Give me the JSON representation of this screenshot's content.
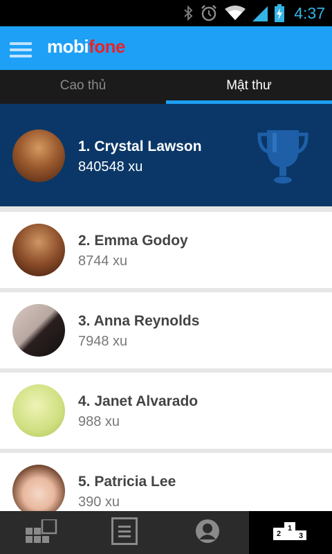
{
  "status_bar": {
    "time": "4:37",
    "icons": [
      "bluetooth-icon",
      "alarm-icon",
      "wifi-icon",
      "signal-icon",
      "battery-charging-icon"
    ]
  },
  "header": {
    "menu_icon": "hamburger-menu-icon",
    "logo_part1": "mobi",
    "logo_part2": "fone",
    "colors": {
      "bar": "#1ea0f7",
      "logo_accent": "#e8232a"
    }
  },
  "tabs": [
    {
      "label": "Cao thủ",
      "active": false
    },
    {
      "label": "Mật thư",
      "active": true
    }
  ],
  "leaderboard": [
    {
      "name": "1. Crystal Lawson",
      "score": "840548 xu",
      "badge_icon": "trophy-icon"
    },
    {
      "name": "2. Emma Godoy",
      "score": "8744 xu"
    },
    {
      "name": "3. Anna Reynolds",
      "score": "7948 xu"
    },
    {
      "name": "4. Janet Alvarado",
      "score": "988 xu"
    },
    {
      "name": "5. Patricia Lee",
      "score": "390 xu"
    }
  ],
  "bottom_nav": [
    {
      "icon": "tiles-icon",
      "active": false
    },
    {
      "icon": "document-list-icon",
      "active": false
    },
    {
      "icon": "profile-icon",
      "active": false
    },
    {
      "icon": "podium-icon",
      "podium_labels": [
        "2",
        "1",
        "3"
      ],
      "active": true
    }
  ]
}
